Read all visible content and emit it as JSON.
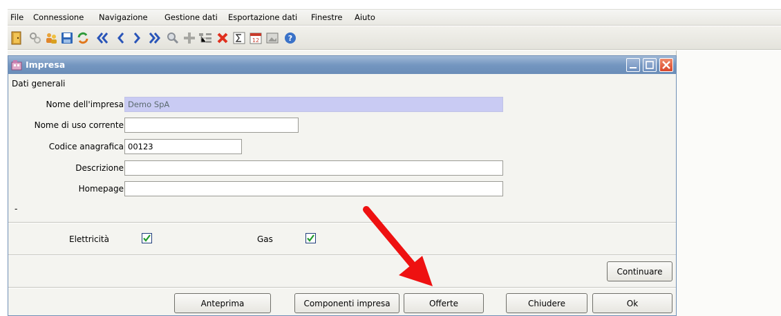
{
  "menubar": {
    "items": [
      "File",
      "Connessione",
      "Navigazione",
      "Gestione dati",
      "Esportazione dati",
      "Finestre",
      "Aiuto"
    ]
  },
  "toolbar": {
    "icons": [
      "exit-icon",
      "tools-icon",
      "users-icon",
      "save-icon",
      "refresh-icon",
      "first-icon",
      "previous-icon",
      "next-icon",
      "last-icon",
      "search-icon",
      "add-icon",
      "tree-icon",
      "delete-icon",
      "sum-icon",
      "calendar-icon",
      "image-icon",
      "help-icon"
    ]
  },
  "window": {
    "title": "Impresa",
    "section": "Dati generali",
    "dash": "-"
  },
  "form": {
    "nome_label": "Nome dell'impresa",
    "nome_value": "Demo SpA",
    "uso_label": "Nome di uso corrente",
    "uso_value": "",
    "codice_label": "Codice anagrafica",
    "codice_value": "00123",
    "descrizione_label": "Descrizione",
    "descrizione_value": "",
    "homepage_label": "Homepage",
    "homepage_value": ""
  },
  "options": {
    "elettricita_label": "Elettricità",
    "elettricita_checked": true,
    "gas_label": "Gas",
    "gas_checked": true
  },
  "buttons": {
    "continuare": "Continuare",
    "anteprima": "Anteprima",
    "componenti": "Componenti impresa",
    "offerte": "Offerte",
    "chiudere": "Chiudere",
    "ok": "Ok"
  },
  "colors": {
    "titlebar": "#7496c0",
    "highlight_input": "#c9cbf3",
    "arrow": "#ee1111",
    "checkmark": "#1e9a2a"
  }
}
